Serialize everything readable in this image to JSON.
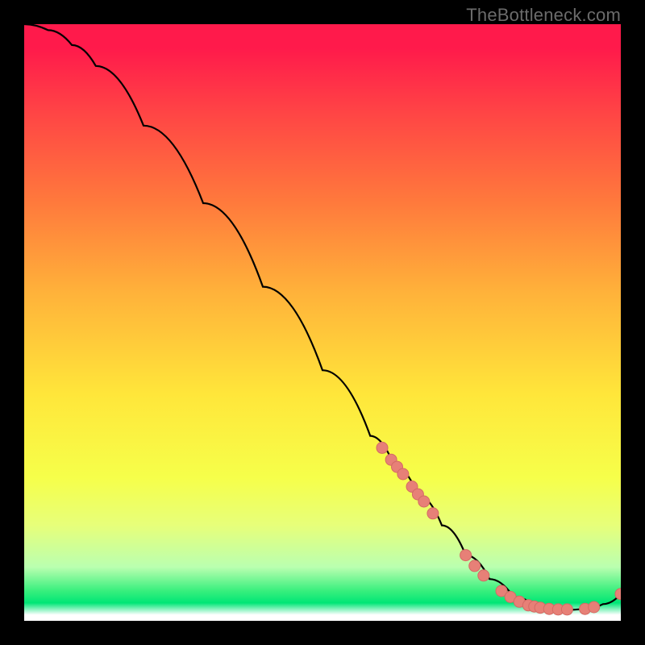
{
  "chart_data": {
    "type": "line",
    "attribution": "TheBottleneck.com",
    "xlim": [
      0,
      100
    ],
    "ylim": [
      0,
      100
    ],
    "curve_percent": [
      {
        "x": 0,
        "y": 100
      },
      {
        "x": 4,
        "y": 99
      },
      {
        "x": 8,
        "y": 96.5
      },
      {
        "x": 12,
        "y": 93
      },
      {
        "x": 20,
        "y": 83
      },
      {
        "x": 30,
        "y": 70
      },
      {
        "x": 40,
        "y": 56
      },
      {
        "x": 50,
        "y": 42
      },
      {
        "x": 58,
        "y": 31
      },
      {
        "x": 62,
        "y": 26
      },
      {
        "x": 66,
        "y": 21
      },
      {
        "x": 70,
        "y": 16
      },
      {
        "x": 74,
        "y": 11
      },
      {
        "x": 78,
        "y": 7
      },
      {
        "x": 82,
        "y": 4
      },
      {
        "x": 86,
        "y": 2.2
      },
      {
        "x": 90,
        "y": 1.8
      },
      {
        "x": 94,
        "y": 2.0
      },
      {
        "x": 97,
        "y": 2.8
      },
      {
        "x": 100,
        "y": 4.5
      }
    ],
    "markers_percent": [
      {
        "x": 60,
        "y": 29
      },
      {
        "x": 61.5,
        "y": 27
      },
      {
        "x": 62.5,
        "y": 25.8
      },
      {
        "x": 63.5,
        "y": 24.6
      },
      {
        "x": 65,
        "y": 22.5
      },
      {
        "x": 66,
        "y": 21.2
      },
      {
        "x": 67,
        "y": 20
      },
      {
        "x": 68.5,
        "y": 18
      },
      {
        "x": 74,
        "y": 11
      },
      {
        "x": 75.5,
        "y": 9.2
      },
      {
        "x": 77,
        "y": 7.6
      },
      {
        "x": 80,
        "y": 5
      },
      {
        "x": 81.5,
        "y": 4
      },
      {
        "x": 83,
        "y": 3.2
      },
      {
        "x": 84.5,
        "y": 2.6
      },
      {
        "x": 85.5,
        "y": 2.4
      },
      {
        "x": 86.5,
        "y": 2.2
      },
      {
        "x": 88,
        "y": 2.0
      },
      {
        "x": 89.5,
        "y": 1.9
      },
      {
        "x": 91,
        "y": 1.9
      },
      {
        "x": 94,
        "y": 2.0
      },
      {
        "x": 95.5,
        "y": 2.3
      },
      {
        "x": 100,
        "y": 4.5
      }
    ],
    "marker_style": {
      "fill": "#e78077",
      "stroke": "#d46a64",
      "radius": 7
    }
  }
}
